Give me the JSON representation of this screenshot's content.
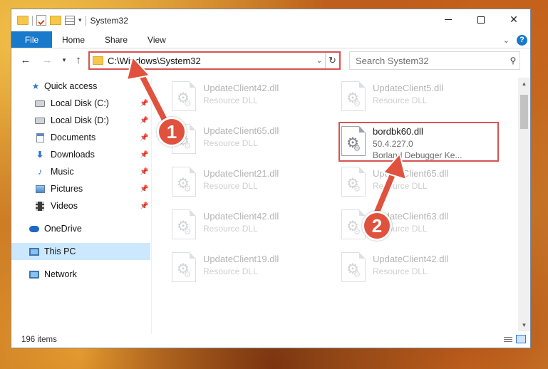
{
  "window": {
    "title": "System32",
    "controls": {
      "minimize": "",
      "maximize": "",
      "close": "✕"
    }
  },
  "ribbon": {
    "tabs": [
      "File",
      "Home",
      "Share",
      "View"
    ]
  },
  "address": {
    "path": "C:\\Windows\\System32",
    "search_placeholder": "Search System32"
  },
  "sidebar": {
    "items": [
      {
        "label": "Quick access",
        "icon": "star-icon"
      },
      {
        "label": "Local Disk (C:)",
        "icon": "drive-icon",
        "pinned": true
      },
      {
        "label": "Local Disk (D:)",
        "icon": "drive-icon",
        "pinned": true
      },
      {
        "label": "Documents",
        "icon": "documents-icon",
        "pinned": true
      },
      {
        "label": "Downloads",
        "icon": "downloads-icon",
        "pinned": true
      },
      {
        "label": "Music",
        "icon": "music-icon",
        "pinned": true
      },
      {
        "label": "Pictures",
        "icon": "pictures-icon",
        "pinned": true
      },
      {
        "label": "Videos",
        "icon": "videos-icon",
        "pinned": true
      },
      {
        "label": "OneDrive",
        "icon": "onedrive-icon"
      },
      {
        "label": "This PC",
        "icon": "this-pc-icon",
        "selected": true
      },
      {
        "label": "Network",
        "icon": "network-icon"
      }
    ]
  },
  "files": [
    {
      "name": "UpdateClient42.dll",
      "desc": "Resource DLL"
    },
    {
      "name": "UpdateClient5.dll",
      "desc": "Resource DLL"
    },
    {
      "name": "UpdateClient65.dll",
      "desc": "Resource DLL"
    },
    {
      "name": "bordbk60.dll",
      "version": "50.4.227.0",
      "desc": "Borland Debugger Ke..."
    },
    {
      "name": "UpdateClient21.dll",
      "desc": "Resource DLL"
    },
    {
      "name": "UpdateClient65.dll",
      "desc": "Resource DLL"
    },
    {
      "name": "UpdateClient42.dll",
      "desc": "Resource DLL"
    },
    {
      "name": "UpdateClient63.dll",
      "desc": "Resource DLL"
    },
    {
      "name": "UpdateClient19.dll",
      "desc": "Resource DLL"
    },
    {
      "name": "UpdateClient42.dll",
      "desc": "Resource DLL"
    }
  ],
  "status": {
    "item_count": "196 items"
  },
  "annotations": {
    "step1": "1",
    "step2": "2",
    "highlight_color": "#d9534f"
  },
  "colors": {
    "accent": "#1979ca",
    "selected": "#cce8ff"
  }
}
